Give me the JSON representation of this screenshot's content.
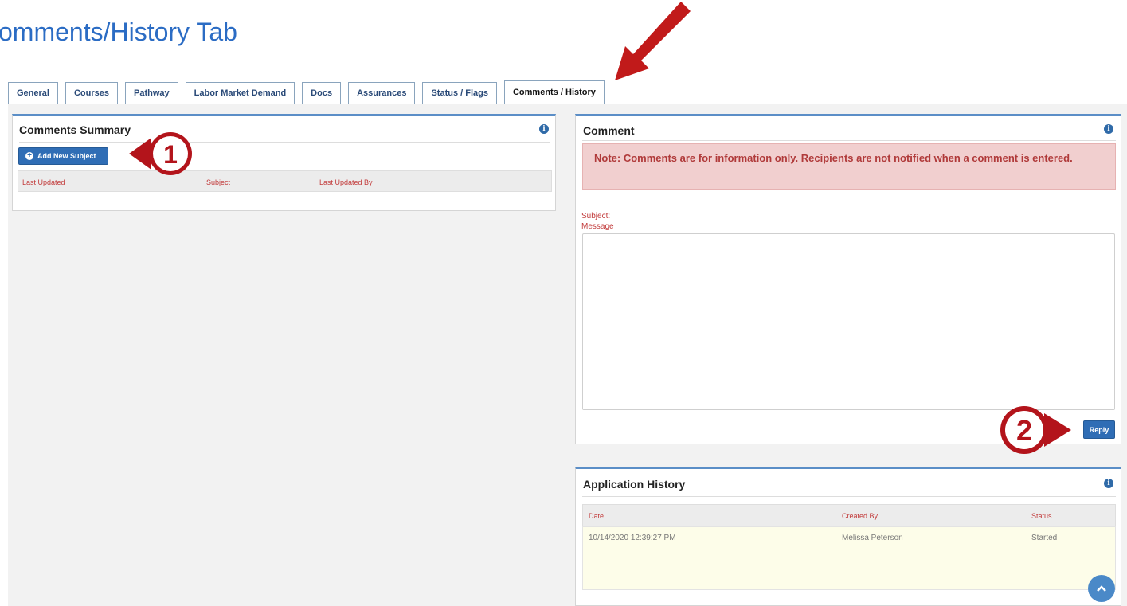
{
  "slide": {
    "title": "omments/History Tab"
  },
  "tabs": [
    {
      "label": "General"
    },
    {
      "label": "Courses"
    },
    {
      "label": "Pathway"
    },
    {
      "label": "Labor Market Demand"
    },
    {
      "label": "Docs"
    },
    {
      "label": "Assurances"
    },
    {
      "label": "Status / Flags"
    },
    {
      "label": "Comments / History",
      "active": true
    }
  ],
  "comments_summary": {
    "title": "Comments Summary",
    "add_button": "Add New Subject",
    "columns": [
      "Last Updated",
      "Subject",
      "Last Updated By"
    ]
  },
  "comment": {
    "title": "Comment",
    "note": "Note: Comments are for information only. Recipients are not notified when a comment is entered.",
    "subject_label": "Subject:",
    "message_label": "Message",
    "message_value": "",
    "reply_button": "Reply"
  },
  "application_history": {
    "title": "Application History",
    "columns": [
      "Date",
      "Created By",
      "Status"
    ],
    "rows": [
      {
        "date": "10/14/2020 12:39:27 PM",
        "created_by": "Melissa Peterson",
        "status": "Started"
      }
    ]
  },
  "callouts": {
    "one": "1",
    "two": "2"
  },
  "icons": {
    "info": "info-circle-icon",
    "plus": "plus-circle-icon",
    "arrow": "red-arrow-pointer",
    "scroll": "chevron-up-icon"
  },
  "colors": {
    "accent": "#2f6db5",
    "title_blue": "#2b6cc4",
    "label_red": "#c23b3b",
    "note_bg": "#f1cfcf",
    "callout_red": "#b3141b"
  }
}
